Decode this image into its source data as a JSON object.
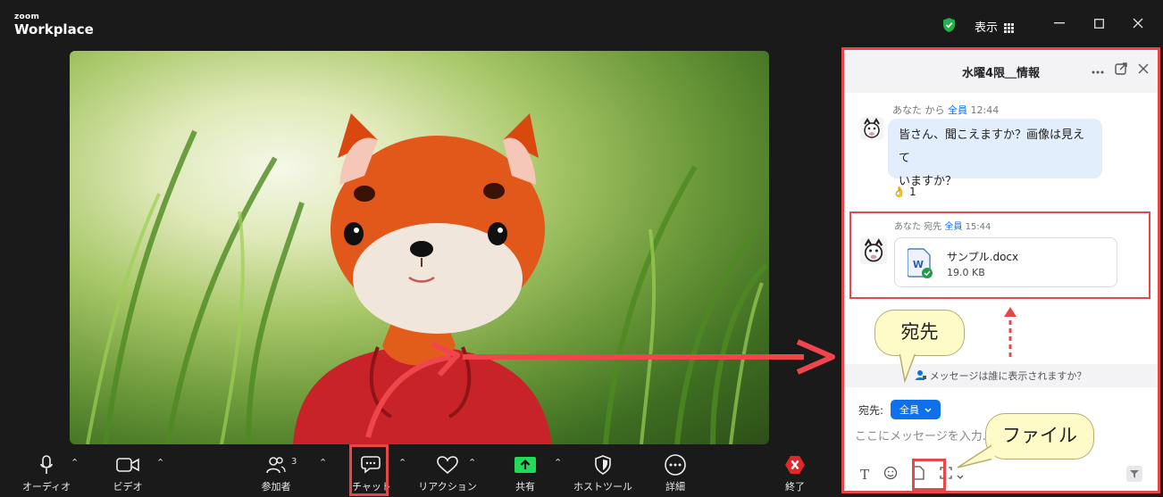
{
  "app": {
    "brand_small": "zoom",
    "brand_large": "Workplace",
    "view_label": "表示"
  },
  "toolbar": {
    "audio": "オーディオ",
    "video": "ビデオ",
    "participants": "参加者",
    "participants_count": "3",
    "chat": "チャット",
    "reactions": "リアクション",
    "share": "共有",
    "host_tools": "ホストツール",
    "more": "詳細",
    "end": "終了"
  },
  "chat": {
    "title": "水曜4限＿情報",
    "msg1": {
      "from": "あなた から",
      "to": "全員",
      "time": "12:44",
      "text_line1": "皆さん、聞こえますか？画像は見えて",
      "text_line2": "いますか？",
      "reaction_count": "1"
    },
    "msg2": {
      "from": "あなた 宛先",
      "to": "全員",
      "time": "15:44",
      "file_name": "サンプル.docx",
      "file_size": "19.0 KB",
      "file_type_letter": "W"
    },
    "visibility_text": "メッセージは誰に表示されますか？",
    "to_label": "宛先:",
    "to_value": "全員",
    "input_placeholder": "ここにメッセージを入力..."
  },
  "annotations": {
    "callout_recipient": "宛先",
    "callout_file": "ファイル"
  },
  "colors": {
    "accent": "#0e71eb",
    "highlight": "#e8474a",
    "callout_bg": "#fffbc8",
    "share_green": "#23d959"
  }
}
